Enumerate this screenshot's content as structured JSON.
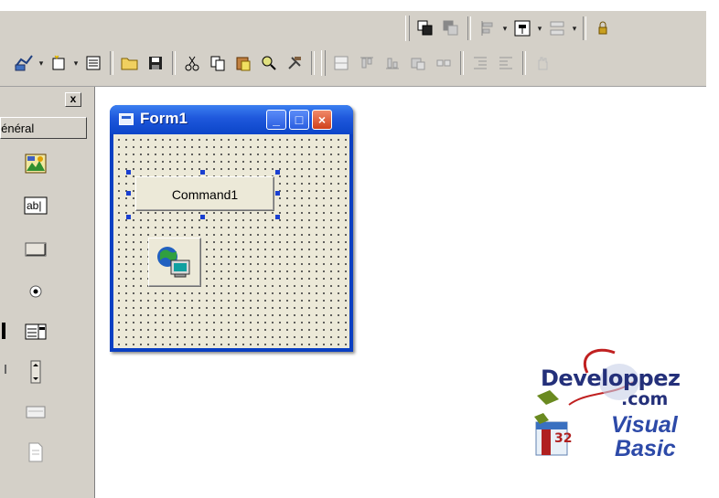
{
  "toolbox": {
    "general_label": "Général",
    "close_label": "x"
  },
  "form": {
    "title": "Form1",
    "command_caption": "Command1"
  },
  "window_buttons": {
    "minimize": "_",
    "maximize": "□",
    "close": "×"
  },
  "logo": {
    "line1": "Developpez",
    "line2": ".com",
    "line3": "Visual",
    "line4": "Basic",
    "badge": "32"
  },
  "toolbar_icons": {
    "row1": [
      "bring-to-front-icon",
      "send-to-back-icon",
      "align-left-icon",
      "center-in-form-icon",
      "make-same-size-icon",
      "lock-controls-icon"
    ],
    "row2": [
      "add-project-icon",
      "add-form-icon",
      "menu-editor-icon",
      "open-project-icon",
      "save-project-icon",
      "cut-icon",
      "copy-icon",
      "paste-icon",
      "find-icon",
      "undo-icon"
    ]
  },
  "colors": {
    "titlebar": "#1e57dc",
    "form_border": "#0a3fc2",
    "client": "#ece9d8",
    "chrome": "#d4d0c8",
    "close_button": "#d0401a"
  }
}
